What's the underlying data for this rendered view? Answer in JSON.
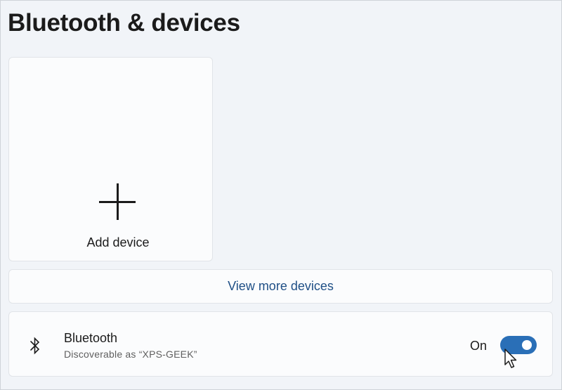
{
  "page": {
    "title": "Bluetooth & devices"
  },
  "add_device": {
    "label": "Add device",
    "icon": "plus-icon"
  },
  "view_more": {
    "label": "View more devices"
  },
  "bluetooth": {
    "title": "Bluetooth",
    "subtitle": "Discoverable as “XPS-GEEK”",
    "toggle_state_label": "On",
    "toggle_on": true,
    "icon": "bluetooth-icon"
  },
  "colors": {
    "accent": "#2a6fb7",
    "link": "#1f4f86",
    "background": "#f1f4f8",
    "card": "#fbfcfd"
  }
}
